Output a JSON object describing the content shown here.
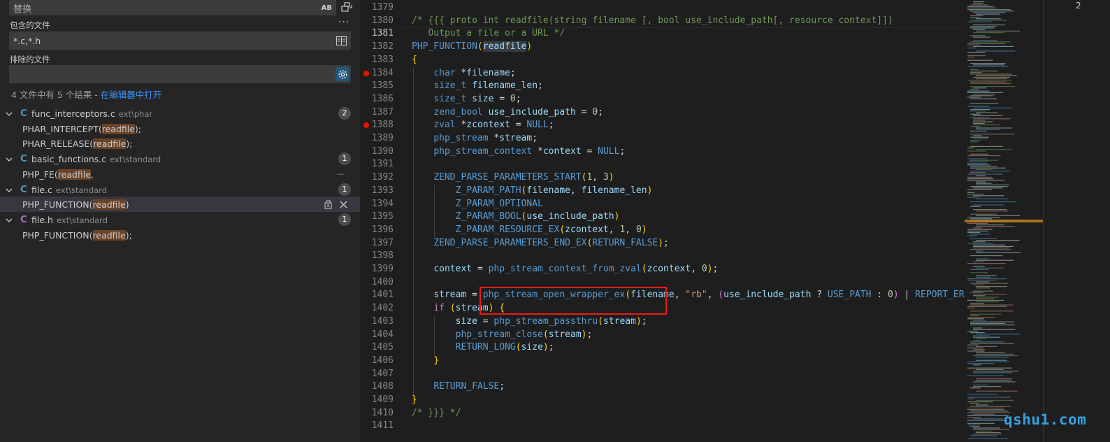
{
  "sidebar": {
    "replace_placeholder": "替换",
    "preserve_case_label": "AB",
    "include_label": "包含的文件",
    "include_value": "*.c,*.h",
    "exclude_label": "排除的文件",
    "exclude_value": "",
    "summary_text": "4 文件中有 5 个结果 - ",
    "summary_link": "在编辑器中打开",
    "results": [
      {
        "lang": "C",
        "lang_color": "#519aba",
        "name": "func_interceptors.c",
        "path": "ext\\phar",
        "count": "2",
        "matches": [
          {
            "before": "PHAR_INTERCEPT(",
            "hit": "readfile",
            "after": ");"
          },
          {
            "before": "PHAR_RELEASE(",
            "hit": "readfile",
            "after": ");"
          }
        ]
      },
      {
        "lang": "C",
        "lang_color": "#519aba",
        "name": "basic_functions.c",
        "path": "ext\\standard",
        "count": "1",
        "matches": [
          {
            "before": "PHP_FE(",
            "hit": "readfile",
            "after": ","
          }
        ]
      },
      {
        "lang": "C",
        "lang_color": "#519aba",
        "name": "file.c",
        "path": "ext\\standard",
        "count": "1",
        "matches": [
          {
            "before": "PHP_FUNCTION(",
            "hit": "readfile",
            "after": ")"
          }
        ]
      },
      {
        "lang": "C",
        "lang_color": "#a074c4",
        "name": "file.h",
        "path": "ext\\standard",
        "count": "1",
        "matches": [
          {
            "before": "PHP_FUNCTION(",
            "hit": "readfile",
            "after": ");"
          }
        ]
      }
    ]
  },
  "editor": {
    "current_line": "1381",
    "breakpoints": [
      "1384",
      "1388"
    ],
    "lines": [
      {
        "n": "1379",
        "t": ""
      },
      {
        "n": "1380",
        "t": "/* {{{ proto int readfile(string filename [, bool use_include_path[, resource context]])"
      },
      {
        "n": "1381",
        "t": "   Output a file or a URL */"
      },
      {
        "n": "1382",
        "t": "PHP_FUNCTION(readfile)"
      },
      {
        "n": "1383",
        "t": "{"
      },
      {
        "n": "1384",
        "t": "    char *filename;"
      },
      {
        "n": "1385",
        "t": "    size_t filename_len;"
      },
      {
        "n": "1386",
        "t": "    size_t size = 0;"
      },
      {
        "n": "1387",
        "t": "    zend_bool use_include_path = 0;"
      },
      {
        "n": "1388",
        "t": "    zval *zcontext = NULL;"
      },
      {
        "n": "1389",
        "t": "    php_stream *stream;"
      },
      {
        "n": "1390",
        "t": "    php_stream_context *context = NULL;"
      },
      {
        "n": "1391",
        "t": ""
      },
      {
        "n": "1392",
        "t": "    ZEND_PARSE_PARAMETERS_START(1, 3)"
      },
      {
        "n": "1393",
        "t": "        Z_PARAM_PATH(filename, filename_len)"
      },
      {
        "n": "1394",
        "t": "        Z_PARAM_OPTIONAL"
      },
      {
        "n": "1395",
        "t": "        Z_PARAM_BOOL(use_include_path)"
      },
      {
        "n": "1396",
        "t": "        Z_PARAM_RESOURCE_EX(zcontext, 1, 0)"
      },
      {
        "n": "1397",
        "t": "    ZEND_PARSE_PARAMETERS_END_EX(RETURN_FALSE);"
      },
      {
        "n": "1398",
        "t": ""
      },
      {
        "n": "1399",
        "t": "    context = php_stream_context_from_zval(zcontext, 0);"
      },
      {
        "n": "1400",
        "t": ""
      },
      {
        "n": "1401",
        "t": "    stream = php_stream_open_wrapper_ex(filename, \"rb\", (use_include_path ? USE_PATH : 0) | REPORT_ERRORS"
      },
      {
        "n": "1402",
        "t": "    if (stream) {"
      },
      {
        "n": "1403",
        "t": "        size = php_stream_passthru(stream);"
      },
      {
        "n": "1404",
        "t": "        php_stream_close(stream);"
      },
      {
        "n": "1405",
        "t": "        RETURN_LONG(size);"
      },
      {
        "n": "1406",
        "t": "    }"
      },
      {
        "n": "1407",
        "t": ""
      },
      {
        "n": "1408",
        "t": "    RETURN_FALSE;"
      },
      {
        "n": "1409",
        "t": "}"
      },
      {
        "n": "1410",
        "t": "/* }}} */"
      },
      {
        "n": "1411",
        "t": ""
      }
    ]
  },
  "right_panel": {
    "value": "2"
  },
  "watermark": "qshu1.com",
  "colors": {
    "accent": "#3794ff",
    "match_highlight": "#6b4326",
    "breakpoint": "#e51400",
    "annotation_box": "#e81b1b"
  }
}
